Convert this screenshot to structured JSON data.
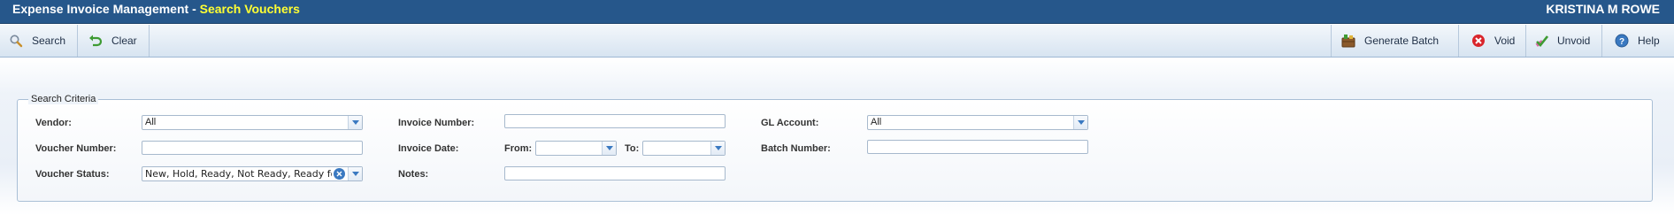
{
  "header": {
    "app_title": "Expense Invoice Management - ",
    "page_title": "Search Vouchers",
    "user_name": "KRISTINA M ROWE"
  },
  "toolbar": {
    "left": [
      {
        "label": "Search",
        "icon": "search-icon"
      },
      {
        "label": "Clear",
        "icon": "undo-icon"
      }
    ],
    "right": [
      {
        "label": "Generate Batch",
        "icon": "generate-batch-icon"
      },
      {
        "label": "Void",
        "icon": "void-icon"
      },
      {
        "label": "Unvoid",
        "icon": "unvoid-icon"
      },
      {
        "label": "Help",
        "icon": "help-icon"
      }
    ]
  },
  "search_criteria": {
    "legend": "Search Criteria",
    "vendor": {
      "label": "Vendor:",
      "value": "All"
    },
    "voucher_number": {
      "label": "Voucher Number:",
      "value": ""
    },
    "voucher_status": {
      "label": "Voucher Status:",
      "value": "New, Hold, Ready, Not Ready, Ready for Batch"
    },
    "invoice_number": {
      "label": "Invoice Number:",
      "value": ""
    },
    "invoice_date": {
      "label": "Invoice Date:",
      "from_label": "From:",
      "to_label": "To:",
      "from_value": "",
      "to_value": ""
    },
    "notes": {
      "label": "Notes:",
      "value": ""
    },
    "gl_account": {
      "label": "GL Account:",
      "value": "All"
    },
    "batch_number": {
      "label": "Batch Number:",
      "value": ""
    }
  },
  "colors": {
    "header_bg": "#26578b",
    "page_title": "#ffff33",
    "toolbar_bg": "#d7e4f1",
    "void_red": "#d9262c",
    "help_blue": "#3a79c1"
  }
}
